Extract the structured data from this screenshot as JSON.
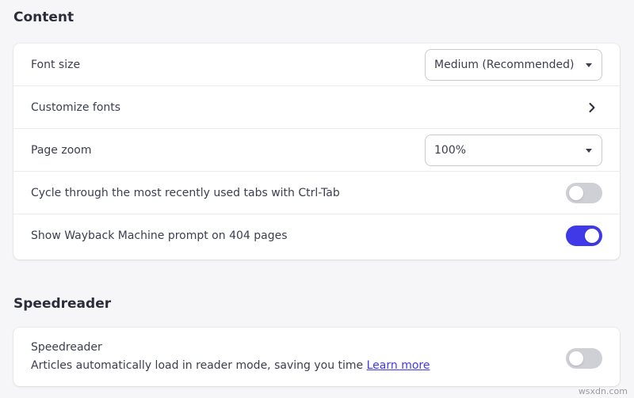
{
  "content": {
    "title": "Content",
    "rows": {
      "font_size": {
        "label": "Font size",
        "value": "Medium (Recommended)"
      },
      "customize_fonts": {
        "label": "Customize fonts",
        "icon": "chevron-right-icon"
      },
      "page_zoom": {
        "label": "Page zoom",
        "value": "100%"
      },
      "cycle_tabs": {
        "label": "Cycle through the most recently used tabs with Ctrl-Tab",
        "enabled": false
      },
      "wayback": {
        "label": "Show Wayback Machine prompt on 404 pages",
        "enabled": true
      }
    }
  },
  "speedreader": {
    "title": "Speedreader",
    "row": {
      "label": "Speedreader",
      "description": "Articles automatically load in reader mode, saving you time",
      "link": "Learn more",
      "enabled": false
    }
  },
  "watermark": "wsxdn.com",
  "colors": {
    "accent": "#3f39e8",
    "toggle_off": "#cfd0d6",
    "background": "#f6f6f8"
  }
}
